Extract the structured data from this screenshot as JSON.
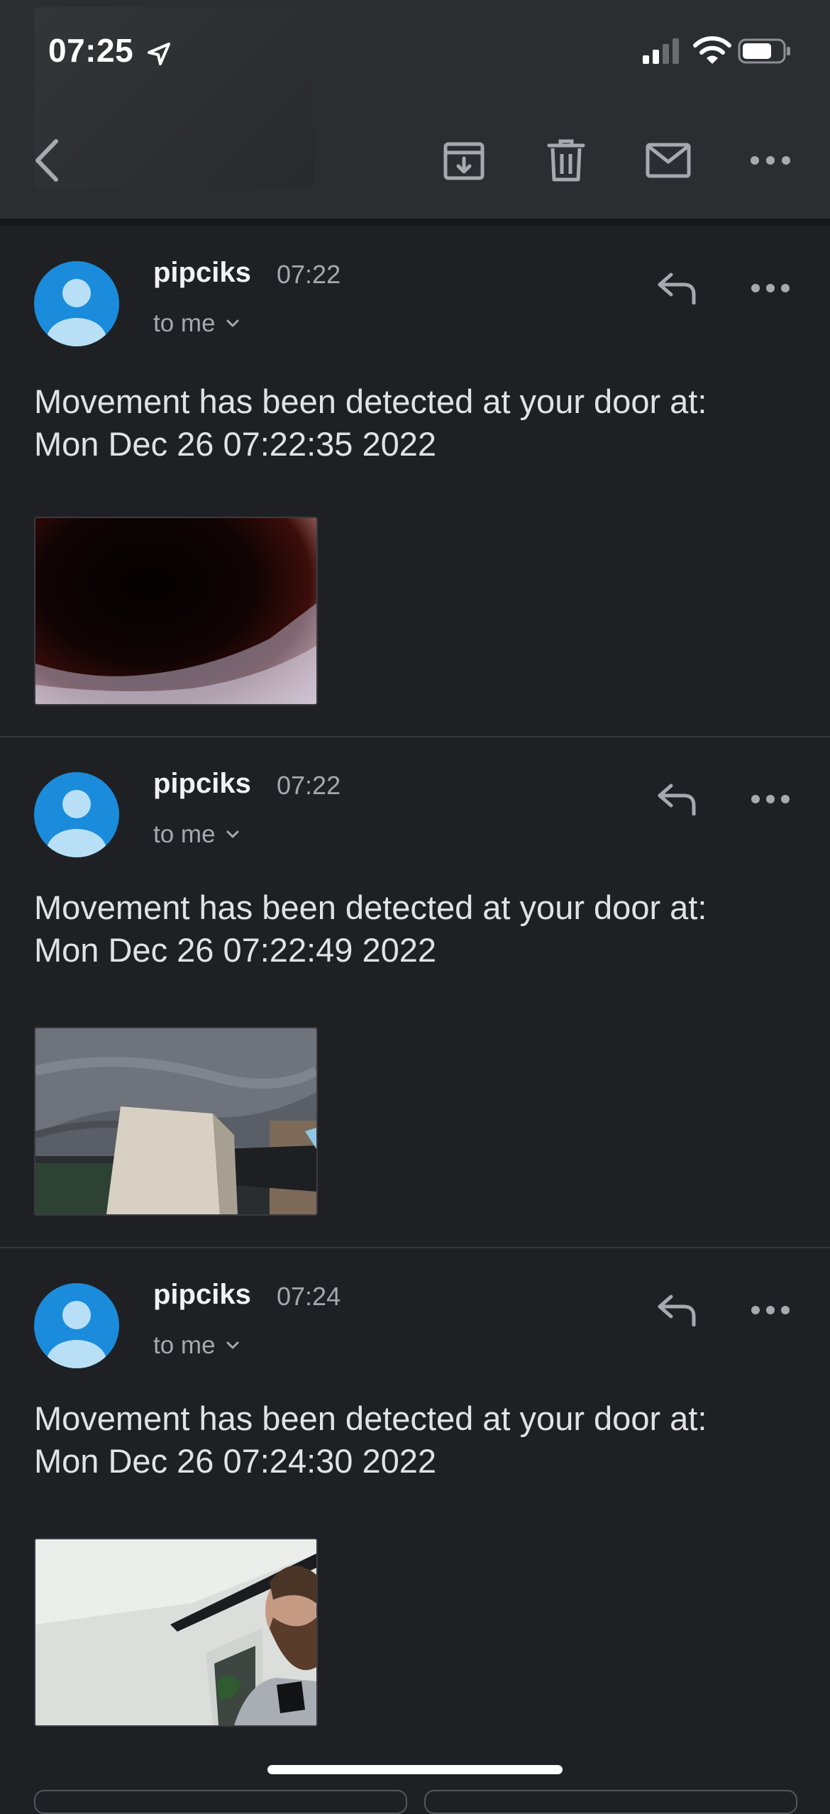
{
  "status_bar": {
    "time": "07:25"
  },
  "toolbar": {
    "icons": [
      "chevron-left-icon",
      "archive-icon",
      "trash-icon",
      "mail-icon",
      "more-horizontal-icon"
    ]
  },
  "messages": [
    {
      "sender": "pipciks",
      "time": "07:22",
      "recipient": "to me",
      "body_line1": "Movement has been detected at your door at:",
      "body_line2": "Mon Dec 26 07:22:35 2022"
    },
    {
      "sender": "pipciks",
      "time": "07:22",
      "recipient": "to me",
      "body_line1": "Movement has been detected at your door at:",
      "body_line2": "Mon Dec 26 07:22:49 2022"
    },
    {
      "sender": "pipciks",
      "time": "07:24",
      "recipient": "to me",
      "body_line1": "Movement has been detected at your door at:",
      "body_line2": "Mon Dec 26 07:24:30 2022"
    }
  ],
  "colors": {
    "background": "#1f2024",
    "toolbar": "#2c2d31",
    "avatar": "#1a8cdb",
    "secondary_text": "#a7a8ad"
  }
}
